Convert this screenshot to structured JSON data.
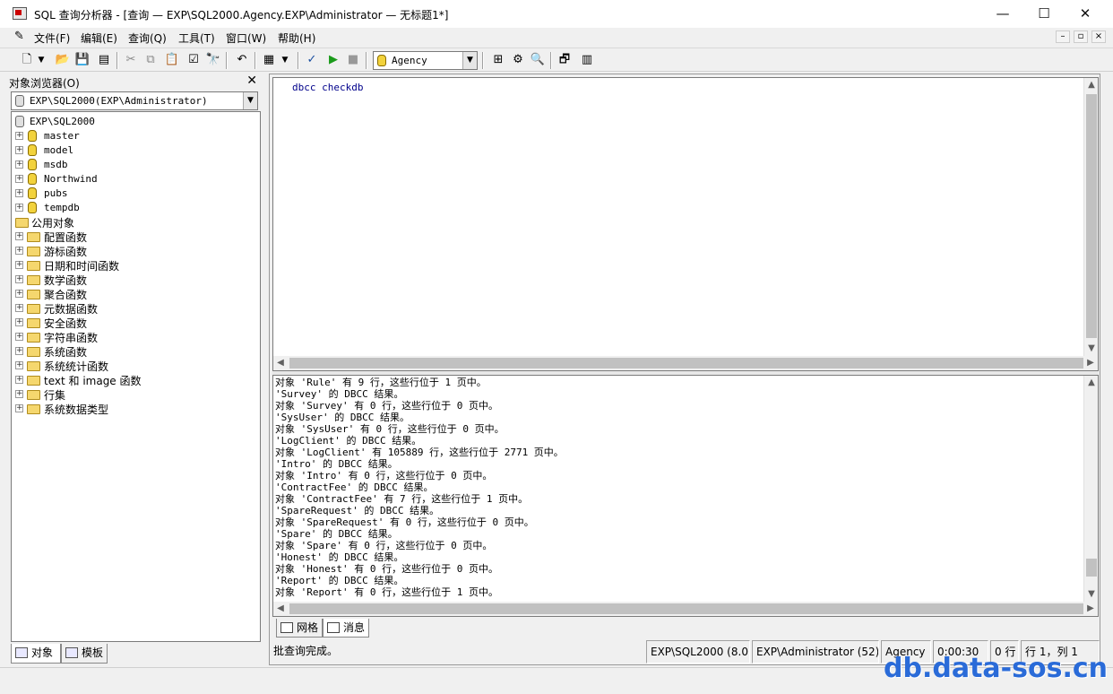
{
  "window": {
    "title": "SQL 查询分析器 - [查询 — EXP\\SQL2000.Agency.EXP\\Administrator — 无标题1*]",
    "minimize": "—",
    "maximize": "☐",
    "close": "✕"
  },
  "menu": {
    "items": [
      "文件(F)",
      "编辑(E)",
      "查询(Q)",
      "工具(T)",
      "窗口(W)",
      "帮助(H)"
    ],
    "mdi_buttons": [
      "–",
      "▫",
      "×"
    ]
  },
  "toolbar": {
    "database": "Agency",
    "icons": [
      "new-query",
      "dropdown-arrow",
      "open-folder",
      "save",
      "load-script",
      "cut",
      "copy",
      "paste",
      "clear-window",
      "find",
      "undo",
      "results-grid",
      "dropdown-arrow",
      "parse-check",
      "execute",
      "stop",
      "display-plan",
      "show-trace",
      "index-tuning",
      "object-properties",
      "object-search"
    ]
  },
  "object_browser": {
    "title": "对象浏览器(O)",
    "close": "✕",
    "server_selector": "EXP\\SQL2000(EXP\\Administrator)",
    "tree": {
      "server": "EXP\\SQL2000",
      "databases": [
        "master",
        "model",
        "msdb",
        "Northwind",
        "pubs",
        "tempdb"
      ],
      "common_objects_label": "公用对象",
      "common_objects": [
        "配置函数",
        "游标函数",
        "日期和时间函数",
        "数学函数",
        "聚合函数",
        "元数据函数",
        "安全函数",
        "字符串函数",
        "系统函数",
        "系统统计函数",
        "text 和 image 函数",
        "行集",
        "系统数据类型"
      ]
    },
    "tabs": [
      "对象",
      "模板"
    ]
  },
  "editor": {
    "text": "dbcc checkdb"
  },
  "results": {
    "lines": [
      "对象 'Rule' 有 9 行，这些行位于 1 页中。",
      "'Survey' 的 DBCC 结果。",
      "对象 'Survey' 有 0 行，这些行位于 0 页中。",
      "'SysUser' 的 DBCC 结果。",
      "对象 'SysUser' 有 0 行，这些行位于 0 页中。",
      "'LogClient' 的 DBCC 结果。",
      "对象 'LogClient' 有 105889 行，这些行位于 2771 页中。",
      "'Intro' 的 DBCC 结果。",
      "对象 'Intro' 有 0 行，这些行位于 0 页中。",
      "'ContractFee' 的 DBCC 结果。",
      "对象 'ContractFee' 有 7 行，这些行位于 1 页中。",
      "'SpareRequest' 的 DBCC 结果。",
      "对象 'SpareRequest' 有 0 行，这些行位于 0 页中。",
      "'Spare' 的 DBCC 结果。",
      "对象 'Spare' 有 0 行，这些行位于 0 页中。",
      "'Honest' 的 DBCC 结果。",
      "对象 'Honest' 有 0 行，这些行位于 0 页中。",
      "'Report' 的 DBCC 结果。",
      "对象 'Report' 有 0 行，这些行位于 1 页中。"
    ],
    "tabs": [
      "网格",
      "消息"
    ]
  },
  "status": {
    "message": "批查询完成。",
    "server": "EXP\\SQL2000 (8.0)",
    "user": "EXP\\Administrator (52)",
    "database": "Agency",
    "elapsed": "0:00:30",
    "rows": "0 行",
    "position": "行 1，列 1"
  },
  "watermark": "db.data-sos.cn",
  "colors": {
    "code_keyword": "#00008b",
    "watermark": "#2a6bd8"
  }
}
